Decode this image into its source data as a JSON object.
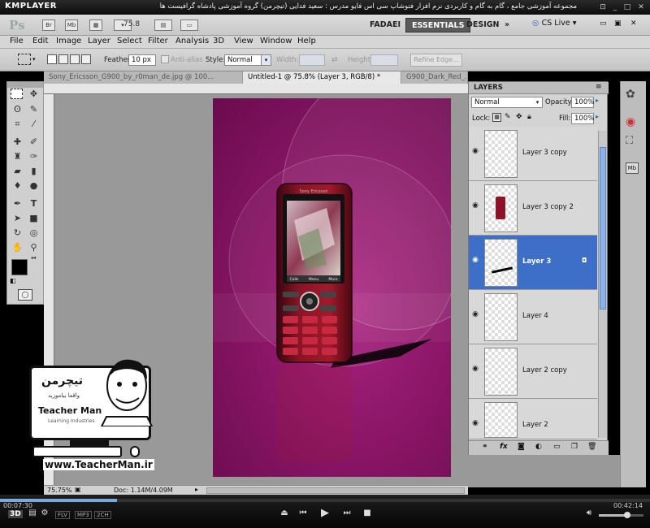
{
  "player": {
    "name": "KMPLAYER",
    "caption": "مجموعه آموزشی جامع ، گام به گام و کاربردی نرم افزار فتوشاپ سی اس فایو   مدرس : سعید فدایی (تیچرمن) گروه آموزشی پادشاه گرافیست ها",
    "time_elapsed": "00:07:30",
    "time_total": "00:42:14",
    "badges": [
      "3D",
      "FLV",
      "MP3",
      "2CH"
    ]
  },
  "appbar": {
    "logo": "Ps",
    "zoom": "75.8",
    "workspaces": [
      "FADAEI",
      "ESSENTIALS",
      "DESIGN"
    ],
    "more": "»",
    "cslive": "CS Live"
  },
  "menu": [
    "File",
    "Edit",
    "Image",
    "Layer",
    "Select",
    "Filter",
    "Analysis",
    "3D",
    "View",
    "Window",
    "Help"
  ],
  "options": {
    "feather_label": "Feather:",
    "feather_value": "10 px",
    "antialias_label": "Anti-alias",
    "style_label": "Style:",
    "style_value": "Normal",
    "width_label": "Width:",
    "height_label": "Height:",
    "refine_label": "Refine Edge..."
  },
  "doc_tabs": [
    "Sony_Ericsson_G900_by_r0man_de.jpg @ 100...",
    "Untitled-1 @ 75.8% (Layer 3, RGB/8) *",
    "G900_Dark_Red_..."
  ],
  "status": {
    "zoom": "75.75%",
    "doc": "Doc: 1.14M/4.09M"
  },
  "layers_panel": {
    "title": "LAYERS",
    "blend_mode": "Normal",
    "opacity_label": "Opacity:",
    "opacity_value": "100%",
    "lock_label": "Lock:",
    "fill_label": "Fill:",
    "fill_value": "100%",
    "layers": [
      {
        "name": "Layer 3 copy",
        "selected": false
      },
      {
        "name": "Layer 3 copy 2",
        "selected": false
      },
      {
        "name": "Layer 3",
        "selected": true
      },
      {
        "name": "Layer 4",
        "selected": false
      },
      {
        "name": "Layer 2 copy",
        "selected": false
      },
      {
        "name": "Layer 2",
        "selected": false
      }
    ]
  },
  "phone": {
    "brand": "Sony Ericsson",
    "softkeys": [
      "Calls",
      "Menu",
      "More"
    ]
  },
  "watermark": {
    "brand_fa": "تیچرمن",
    "subtitle_fa": "واقعا بیاموزید",
    "brand_en": "Teacher Man",
    "tagline": "Learning Industries",
    "url": "www.TeacherMan.ir"
  },
  "colors": {
    "selection": "#3d6fc9",
    "artboard": "#8c1668",
    "phone_red": "#7a0d1e"
  }
}
